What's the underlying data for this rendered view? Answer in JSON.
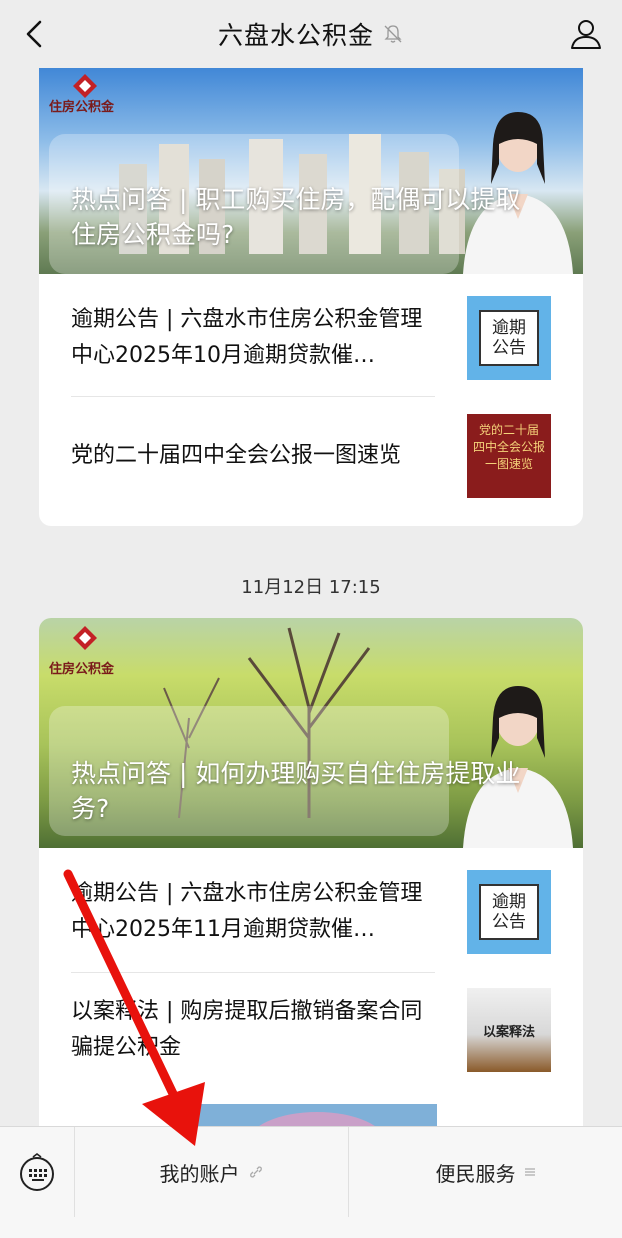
{
  "header": {
    "title": "六盘水公积金",
    "back_icon": "chevron-left-icon",
    "mute_icon": "bell-off-icon",
    "profile_icon": "person-icon"
  },
  "articles": [
    {
      "cover": {
        "logo_text": "住房公积金",
        "headline": "热点问答 | 职工购买住房，配偶可以提取住房公积金吗?"
      },
      "items": [
        {
          "title": "逾期公告 | 六盘水市住房公积金管理中心2025年10月逾期贷款催…",
          "thumb_text": "逾期\n公告"
        },
        {
          "title": "党的二十届四中全会公报一图速览",
          "thumb_text": "党的二十届\n四中全会公报\n一图速览"
        }
      ]
    },
    {
      "timestamp": "11月12日 17:15",
      "cover": {
        "logo_text": "住房公积金",
        "headline": "热点问答 | 如何办理购买自住住房提取业务?"
      },
      "items": [
        {
          "title": "逾期公告 | 六盘水市住房公积金管理中心2025年11月逾期贷款催…",
          "thumb_text": "逾期\n公告"
        },
        {
          "title": "以案释法 | 购房提取后撤销备案合同骗提公积金",
          "thumb_text": "以案释法"
        }
      ]
    }
  ],
  "bottom_menu": {
    "keyboard_icon": "keyboard-icon",
    "items": [
      {
        "label": "我的账户",
        "icon": "link-icon"
      },
      {
        "label": "便民服务",
        "icon": "menu-lines-icon"
      }
    ]
  },
  "colors": {
    "annotation_arrow": "#e8120c",
    "page_background": "#ededed"
  }
}
